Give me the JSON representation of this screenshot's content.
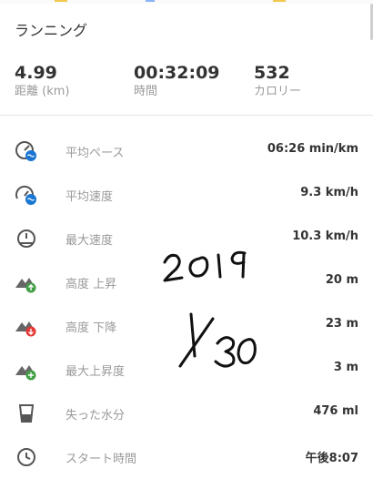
{
  "header": {
    "title": "ランニング"
  },
  "summary": [
    {
      "value": "4.99",
      "label": "距離 (km)"
    },
    {
      "value": "00:32:09",
      "label": "時間"
    },
    {
      "value": "532",
      "label": "カロリー"
    }
  ],
  "stats": [
    {
      "icon": "pace-gauge-icon",
      "label": "平均ペース",
      "value": "06:26 min/km"
    },
    {
      "icon": "speed-gauge-icon",
      "label": "平均速度",
      "value": "9.3 km/h"
    },
    {
      "icon": "speedometer-icon",
      "label": "最大速度",
      "value": "10.3 km/h"
    },
    {
      "icon": "elevation-up-icon",
      "label": "高度 上昇",
      "value": "20 m"
    },
    {
      "icon": "elevation-down-icon",
      "label": "高度 下降",
      "value": "23 m"
    },
    {
      "icon": "elevation-max-icon",
      "label": "最大上昇度",
      "value": "3 m"
    },
    {
      "icon": "water-glass-icon",
      "label": "失った水分",
      "value": "476 ml"
    },
    {
      "icon": "clock-icon",
      "label": "スタート時間",
      "value": "午後8:07"
    }
  ],
  "handwriting": {
    "year": "2019",
    "date": "1/30"
  },
  "colors": {
    "accent_blue": "#1976d2",
    "up_green": "#43a047",
    "down_red": "#e53935",
    "icon_gray": "#555555"
  }
}
